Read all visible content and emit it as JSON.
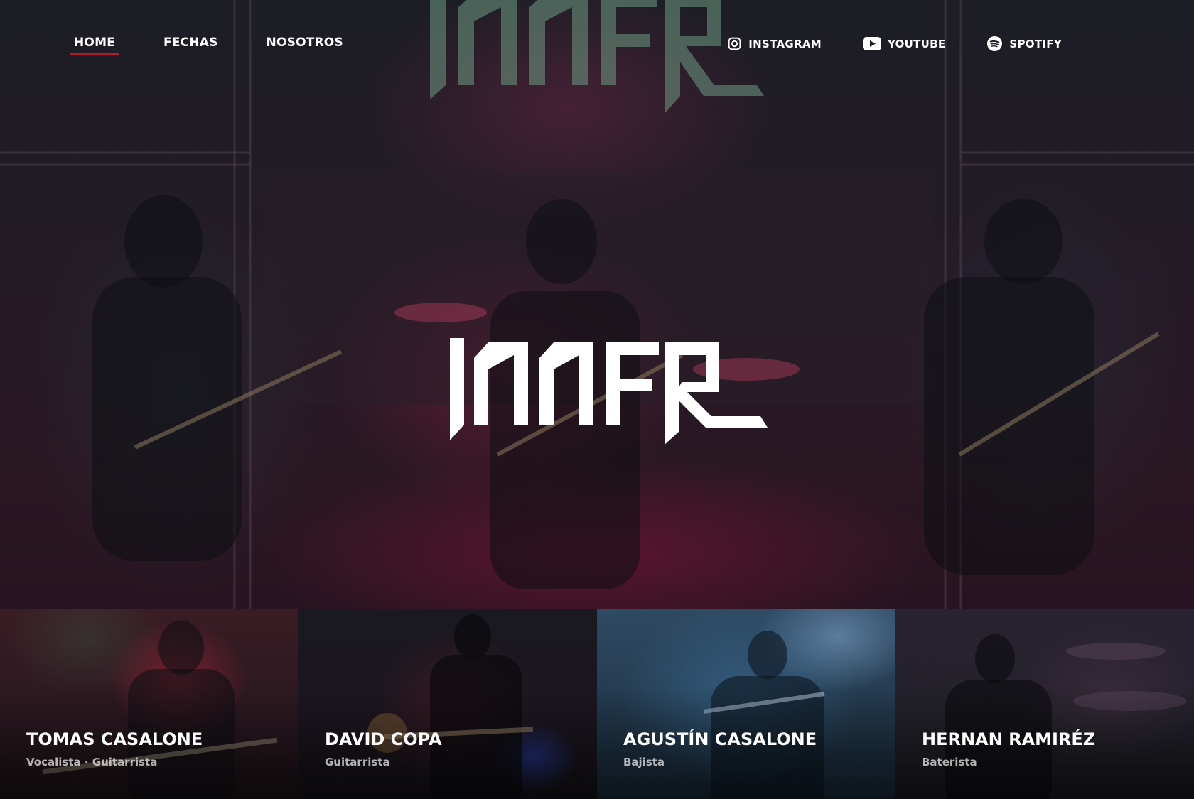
{
  "nav": {
    "items": [
      {
        "label": "HOME",
        "active": true
      },
      {
        "label": "FECHAS",
        "active": false
      },
      {
        "label": "NOSOTROS",
        "active": false
      }
    ],
    "social": [
      {
        "label": "INSTAGRAM",
        "icon": "instagram-icon"
      },
      {
        "label": "YOUTUBE",
        "icon": "youtube-icon"
      },
      {
        "label": "SPOTIFY",
        "icon": "spotify-icon"
      }
    ]
  },
  "hero": {
    "logo": "JANER"
  },
  "members": [
    {
      "name": "TOMAS CASALONE",
      "role": "Vocalista · Guitarrista"
    },
    {
      "name": "DAVID COPA",
      "role": "Guitarrista"
    },
    {
      "name": "AGUSTÍN CASALONE",
      "role": "Bajista"
    },
    {
      "name": "HERNAN RAMIRÉZ",
      "role": "Baterista"
    }
  ],
  "colors": {
    "accent": "#b31b2b",
    "text": "#ffffff",
    "bg_logo": "#6e9c83"
  }
}
